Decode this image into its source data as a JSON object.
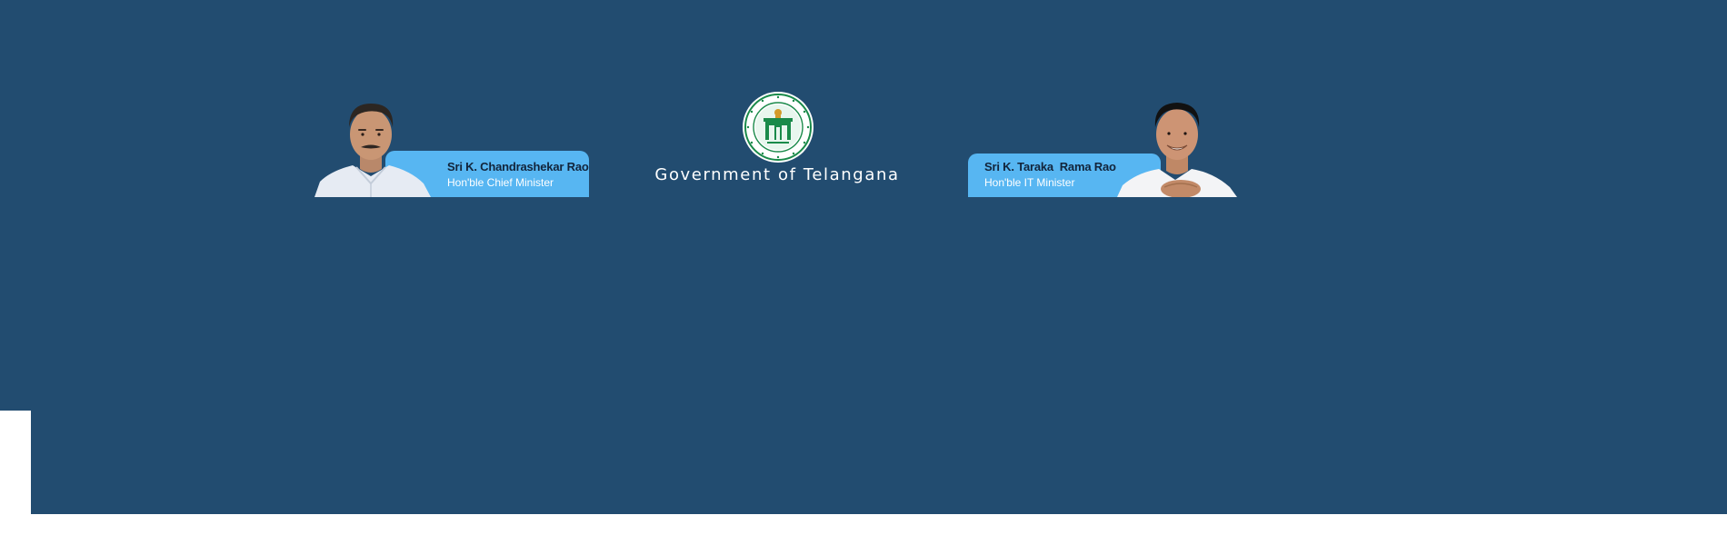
{
  "header": {
    "title": "Government of Telangana",
    "emblem": {
      "icon": "telangana-state-emblem",
      "outer_text": "GOVERNMENT OF TELANGANA"
    },
    "background_color": "#224c70",
    "accent_color": "#57b6f2"
  },
  "leaders": {
    "left": {
      "name": "Sri K. Chandrashekar Rao",
      "role": "Hon'ble Chief Minister"
    },
    "right": {
      "name": "Sri K. Taraka  Rama Rao",
      "role": "Hon'ble IT Minister"
    }
  }
}
